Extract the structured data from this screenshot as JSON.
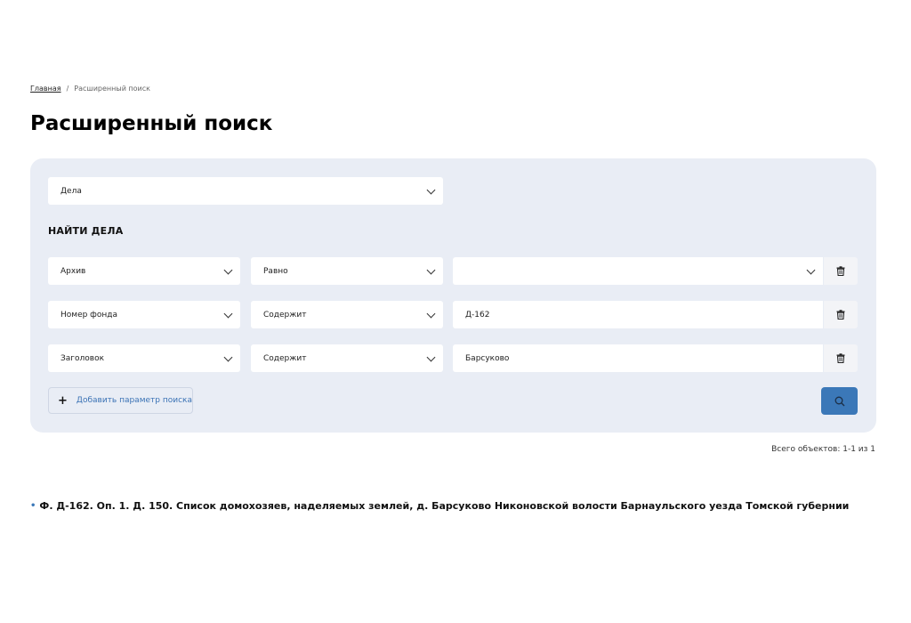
{
  "breadcrumb": {
    "home": "Главная",
    "separator": "/",
    "current": "Расширенный поиск"
  },
  "page_title": "Расширенный поиск",
  "type_select": {
    "value": "Дела"
  },
  "section_title": "НАЙТИ ДЕЛА",
  "rows": [
    {
      "field": "Архив",
      "operator": "Равно",
      "value": ""
    },
    {
      "field": "Номер фонда",
      "operator": "Содержит",
      "value": "Д-162"
    },
    {
      "field": "Заголовок",
      "operator": "Содержит",
      "value": "Барсуково"
    }
  ],
  "add_param_label": "Добавить параметр поиска",
  "total_label": "Всего объектов: 1-1 из 1",
  "results": [
    "Ф. Д-162. Оп. 1. Д. 150. Список домохозяев, наделяемых землей, д. Барсуково Никоновской волости Барнаульского уезда Томской губернии"
  ],
  "colors": {
    "panel": "#e9edf5",
    "accent": "#3b78b8",
    "link": "#3a72b5"
  }
}
